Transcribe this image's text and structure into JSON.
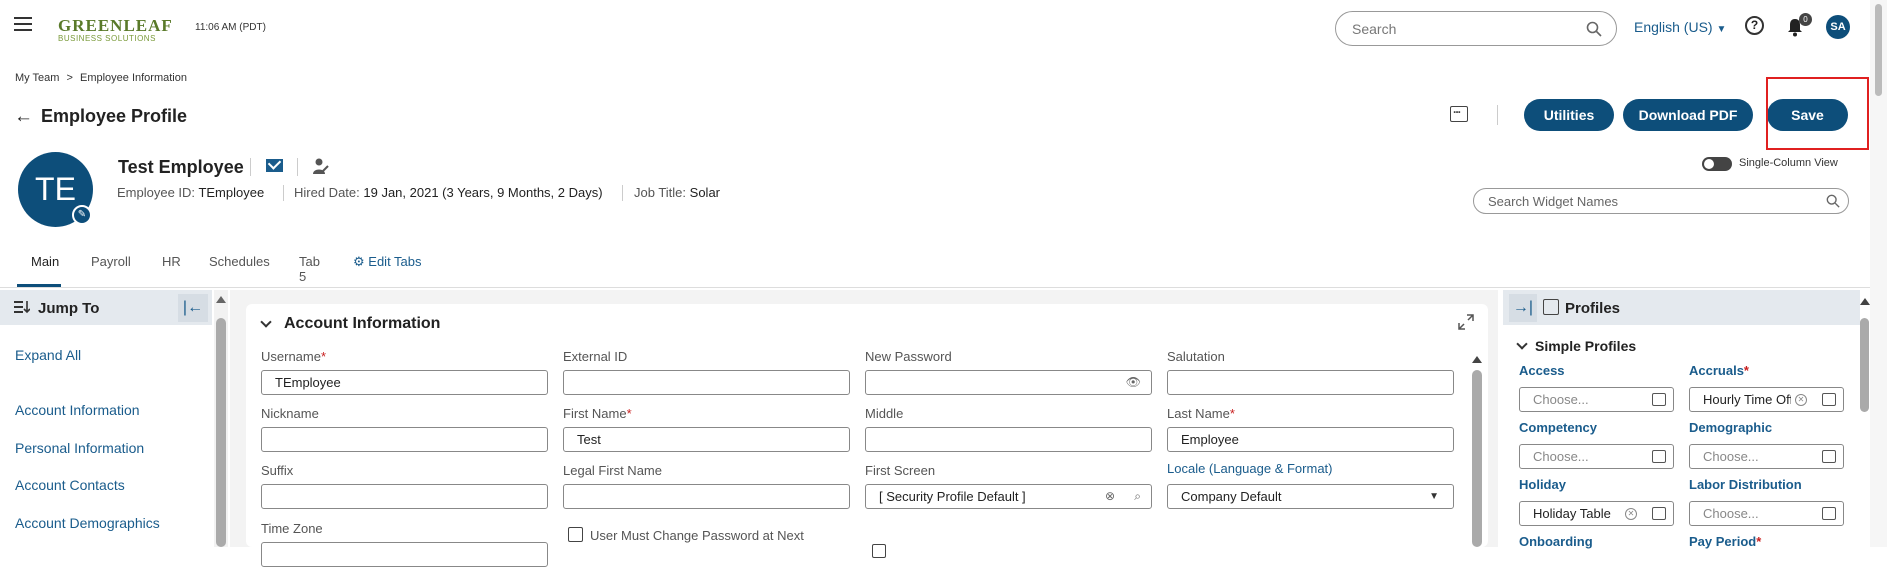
{
  "topbar": {
    "logo_line1": "GREENLEAF",
    "logo_line2": "BUSINESS SOLUTIONS",
    "time": "11:06 AM (PDT)",
    "search_placeholder": "Search",
    "language": "English (US)",
    "notification_count": "0",
    "user_initials": "SA"
  },
  "breadcrumb": {
    "items": [
      "My Team",
      ">",
      "Employee Information"
    ]
  },
  "header": {
    "title": "Employee Profile",
    "utilities_label": "Utilities",
    "download_label": "Download PDF",
    "save_label": "Save"
  },
  "employee": {
    "initials": "TE",
    "name": "Test Employee",
    "id_label": "Employee ID:",
    "id_value": "TEmployee",
    "hired_label": "Hired Date:",
    "hired_value": "19 Jan, 2021 (3 Years, 9 Months, 2 Days)",
    "job_label": "Job Title:",
    "job_value": "Solar"
  },
  "view_toggle_label": "Single-Column View",
  "widget_search_placeholder": "Search Widget Names",
  "tabs": [
    "Main",
    "Payroll",
    "HR",
    "Schedules",
    "Tab 5"
  ],
  "edit_tabs_label": "Edit Tabs",
  "jump": {
    "title": "Jump To",
    "expand_all": "Expand All",
    "links": [
      "Account Information",
      "Personal Information",
      "Account Contacts",
      "Account Demographics"
    ]
  },
  "account": {
    "title": "Account Information",
    "fields": {
      "username": {
        "label": "Username",
        "value": "TEmployee"
      },
      "external_id": {
        "label": "External ID",
        "value": ""
      },
      "new_password": {
        "label": "New Password",
        "value": ""
      },
      "salutation": {
        "label": "Salutation",
        "value": ""
      },
      "nickname": {
        "label": "Nickname",
        "value": ""
      },
      "first_name": {
        "label": "First Name",
        "value": "Test"
      },
      "middle": {
        "label": "Middle",
        "value": ""
      },
      "last_name": {
        "label": "Last Name",
        "value": "Employee"
      },
      "suffix": {
        "label": "Suffix",
        "value": ""
      },
      "legal_first_name": {
        "label": "Legal First Name",
        "value": ""
      },
      "first_screen": {
        "label": "First Screen",
        "value": "[ Security Profile Default ]"
      },
      "locale": {
        "label": "Locale (Language & Format)",
        "value": "Company Default"
      },
      "time_zone": {
        "label": "Time Zone",
        "value": ""
      }
    },
    "must_change_password_label": "User Must Change Password at Next"
  },
  "profiles": {
    "title": "Profiles",
    "subtitle": "Simple Profiles",
    "placeholder": "Choose...",
    "items": {
      "access": {
        "label": "Access",
        "value": ""
      },
      "accruals": {
        "label": "Accruals",
        "value": "Hourly Time Off"
      },
      "competency": {
        "label": "Competency",
        "value": ""
      },
      "demographic": {
        "label": "Demographic",
        "value": ""
      },
      "holiday": {
        "label": "Holiday",
        "value": "Holiday Table"
      },
      "labor_distribution": {
        "label": "Labor Distribution",
        "value": ""
      },
      "onboarding": {
        "label": "Onboarding",
        "value": ""
      },
      "pay_period": {
        "label": "Pay Period",
        "value": ""
      }
    }
  },
  "colors": {
    "brand": "#0d4e7a",
    "link": "#1a5c8c",
    "required": "#c81e1e",
    "highlight": "#e02020"
  }
}
